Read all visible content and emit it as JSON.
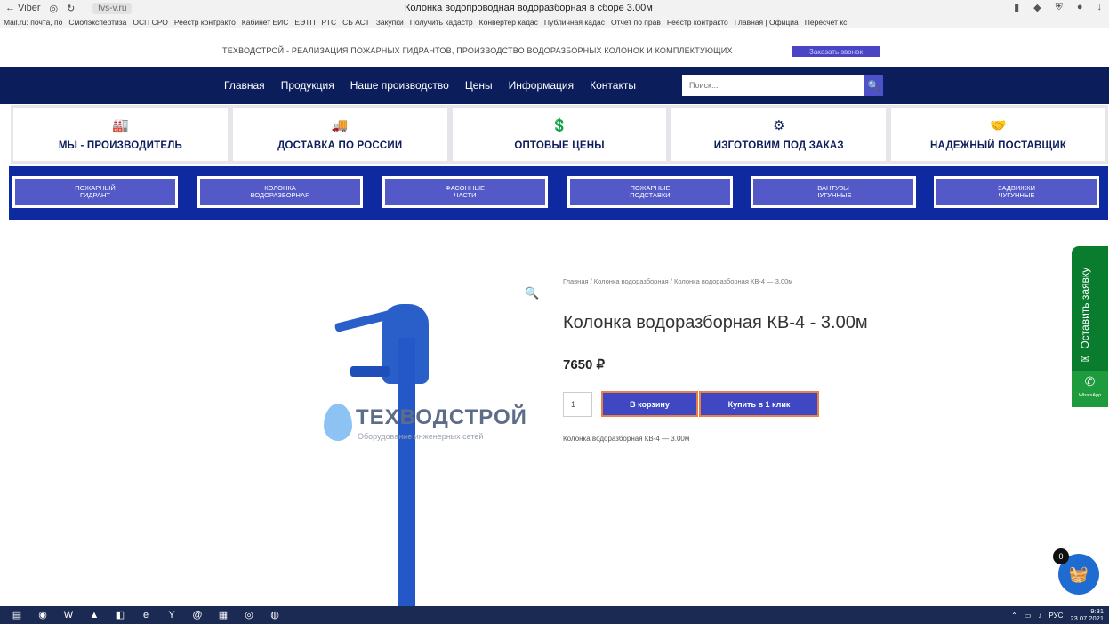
{
  "browser": {
    "back_label": "← Viber",
    "url": "tvs-v.ru",
    "tab_title": "Колонка водопроводная водоразборная в сборе 3.00м",
    "bookmarks": [
      "Mail.ru: почта, по",
      "Смолэкспертиза",
      "ОСП СРО",
      "Реестр контракто",
      "Кабинет ЕИС",
      "ЕЭТП",
      "РТС",
      "СБ АСТ",
      "Закупки",
      "Получить кадастр",
      "Конвертер кадас",
      "Публичная кадас",
      "Отчет по прав",
      "Реестр контракто",
      "Главная | Официа",
      "Пересчет кс"
    ]
  },
  "header": {
    "tagline": "ТЕХВОДСТРОЙ - РЕАЛИЗАЦИЯ ПОЖАРНЫХ ГИДРАНТОВ, ПРОИЗВОДСТВО ВОДОРАЗБОРНЫХ КОЛОНОК И КОМПЛЕКТУЮЩИХ",
    "callback_label": "Заказать звонок"
  },
  "nav": {
    "items": [
      "Главная",
      "Продукция",
      "Наше производство",
      "Цены",
      "Информация",
      "Контакты"
    ],
    "search_placeholder": "Поиск..."
  },
  "features": [
    {
      "icon": "factory-icon",
      "glyph": "🏭",
      "label": "МЫ - ПРОИЗВОДИТЕЛЬ"
    },
    {
      "icon": "truck-icon",
      "glyph": "🚚",
      "label": "ДОСТАВКА ПО РОССИИ"
    },
    {
      "icon": "hand-coin-icon",
      "glyph": "💲",
      "label": "ОПТОВЫЕ ЦЕНЫ"
    },
    {
      "icon": "gears-icon",
      "glyph": "⚙",
      "label": "ИЗГОТОВИМ ПОД ЗАКАЗ"
    },
    {
      "icon": "handshake-icon",
      "glyph": "🤝",
      "label": "НАДЕЖНЫЙ ПОСТАВЩИК"
    }
  ],
  "categories": [
    {
      "line1": "ПОЖАРНЫЙ",
      "line2": "ГИДРАНТ"
    },
    {
      "line1": "КОЛОНКА",
      "line2": "ВОДОРАЗБОРНАЯ"
    },
    {
      "line1": "ФАСОННЫЕ",
      "line2": "ЧАСТИ"
    },
    {
      "line1": "ПОЖАРНЫЕ",
      "line2": "ПОДСТАВКИ"
    },
    {
      "line1": "ВАНТУЗЫ",
      "line2": "ЧУГУННЫЕ"
    },
    {
      "line1": "ЗАДВИЖКИ",
      "line2": "ЧУГУННЫЕ"
    }
  ],
  "product": {
    "breadcrumb": "Главная / Колонка водоразборная / Колонка водоразборная КВ-4 — 3.00м",
    "title": "Колонка водоразборная КВ-4 - 3.00м",
    "price": "7650 ₽",
    "quantity": "1",
    "add_to_cart_label": "В корзину",
    "buy_one_click_label": "Купить в 1 клик",
    "short_description": "Колонка водоразборная КВ-4 — 3.00м",
    "watermark_brand": "ТЕХВОДСТРОЙ",
    "watermark_sub": "Оборудование инженерных сетей"
  },
  "widgets": {
    "request_label": "Оставить заявку",
    "whatsapp_label": "WhatsApp",
    "cart_count": "0"
  },
  "taskbar": {
    "lang": "РУС",
    "time": "9:31",
    "date": "23.07.2021"
  },
  "colors": {
    "navy": "#0c1d5b",
    "category_bg": "#0f2aa0",
    "button": "#3f47c3",
    "button_border": "#e67f48",
    "side_green": "#0a7c2e"
  }
}
